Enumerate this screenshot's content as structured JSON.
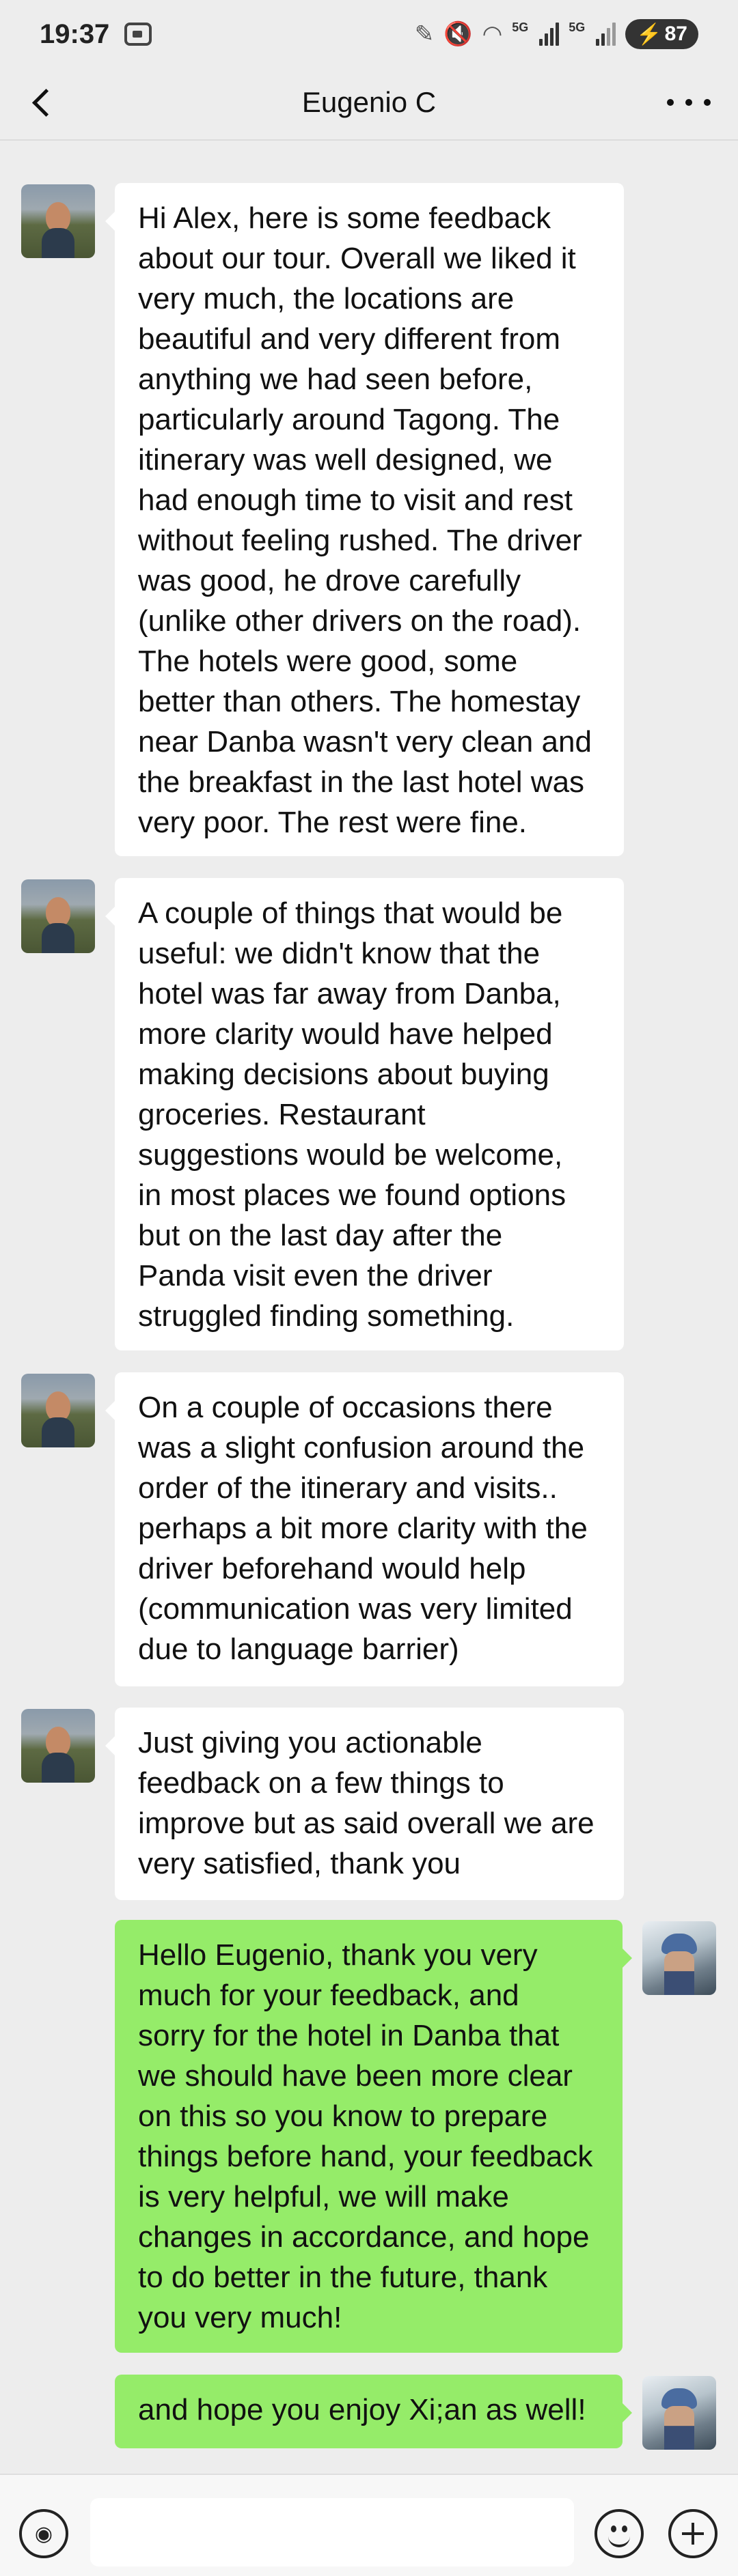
{
  "status_bar": {
    "time": "19:37",
    "signal_1_label": "5G",
    "signal_2_label": "5G",
    "battery": "87",
    "icons": [
      "screen-record-icon",
      "pen-icon",
      "mute-icon",
      "wifi-icon",
      "signal-icon",
      "signal-icon",
      "charging-icon"
    ]
  },
  "header": {
    "title": "Eugenio C",
    "back_icon": "back-chevron-icon",
    "more_icon": "more-dots-icon"
  },
  "messages": [
    {
      "sender": "Eugenio C",
      "side": "left",
      "text": "Hi Alex, here is some feedback\nabout our tour. Overall we liked it\nvery much, the locations are\nbeautiful and very different from\nanything we had seen before,\nparticularly around Tagong. The\nitinerary was well designed, we\nhad enough time to visit and rest\nwithout feeling rushed. The driver\nwas good, he drove carefully\n(unlike other drivers on the road).\nThe hotels were good, some\nbetter than others. The homestay\nnear Danba wasn't very clean and\nthe breakfast in the last hotel was\nvery poor. The rest were fine."
    },
    {
      "sender": "Eugenio C",
      "side": "left",
      "text": "A couple of things that would be\nuseful: we didn't know that the\nhotel was far away from Danba,\nmore clarity would have helped\nmaking decisions about buying\ngroceries. Restaurant\nsuggestions would be welcome,\nin most places we found options\nbut on the last day after the\nPanda visit even the driver\nstruggled finding something."
    },
    {
      "sender": "Eugenio C",
      "side": "left",
      "text": "On a couple of occasions there\nwas a slight confusion around the\norder of the itinerary and visits..\nperhaps a bit more clarity with the\ndriver beforehand would help\n(communication was very limited\ndue to language barrier)"
    },
    {
      "sender": "Eugenio C",
      "side": "left",
      "text": "Just giving you actionable\nfeedback on a few things to\nimprove but as said overall we are\nvery satisfied, thank you"
    },
    {
      "sender": "me",
      "side": "right",
      "text": "Hello Eugenio, thank you very\nmuch for your feedback, and\nsorry for the hotel in Danba that\nwe should have been more clear\non this so you know to prepare\nthings before hand, your feedback\nis very helpful, we will make\nchanges in accordance, and hope\nto do better in the future, thank\nyou very much!"
    },
    {
      "sender": "me",
      "side": "right",
      "text": "and hope you enjoy Xi;an as well!"
    }
  ],
  "input_bar": {
    "text_value": "",
    "voice_icon": "voice-icon",
    "emoji_icon": "emoji-icon",
    "plus_icon": "plus-icon"
  },
  "colors": {
    "background": "#ededed",
    "incoming_bubble": "#ffffff",
    "outgoing_bubble": "#95ec69"
  }
}
